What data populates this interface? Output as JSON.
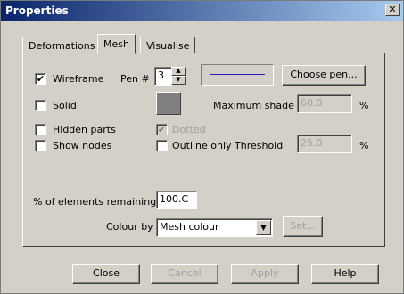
{
  "window": {
    "title": "Properties"
  },
  "tabs": [
    {
      "label": "Deformations"
    },
    {
      "label": "Mesh"
    },
    {
      "label": "Visualise"
    }
  ],
  "mesh": {
    "wireframe": {
      "label": "Wireframe",
      "checked": "✔"
    },
    "pen_label": "Pen #",
    "pen_value": "3",
    "choose_pen_label": "Choose pen...",
    "solid": {
      "label": "Solid",
      "checked": ""
    },
    "max_shade_label": "Maximum shade",
    "max_shade_value": "60.0",
    "max_shade_unit": "%",
    "hidden_parts": {
      "label": "Hidden parts",
      "checked": ""
    },
    "dotted": {
      "label": "Dotted",
      "checked": "✔"
    },
    "show_nodes": {
      "label": "Show nodes",
      "checked": ""
    },
    "outline_only": {
      "label": "Outline only",
      "checked": ""
    },
    "threshold_label": "Threshold",
    "threshold_value": "25.0",
    "threshold_unit": "%",
    "elements_remaining_label": "% of elements remaining",
    "elements_remaining_value": "100.C",
    "colour_by_label": "Colour by",
    "colour_by_value": "Mesh colour",
    "set_label": "Set..."
  },
  "buttons": {
    "close": "Close",
    "cancel": "Cancel",
    "apply": "Apply",
    "help": "Help"
  },
  "colors": {
    "pen_line": "#2020c0",
    "shade_swatch": "#808080"
  }
}
